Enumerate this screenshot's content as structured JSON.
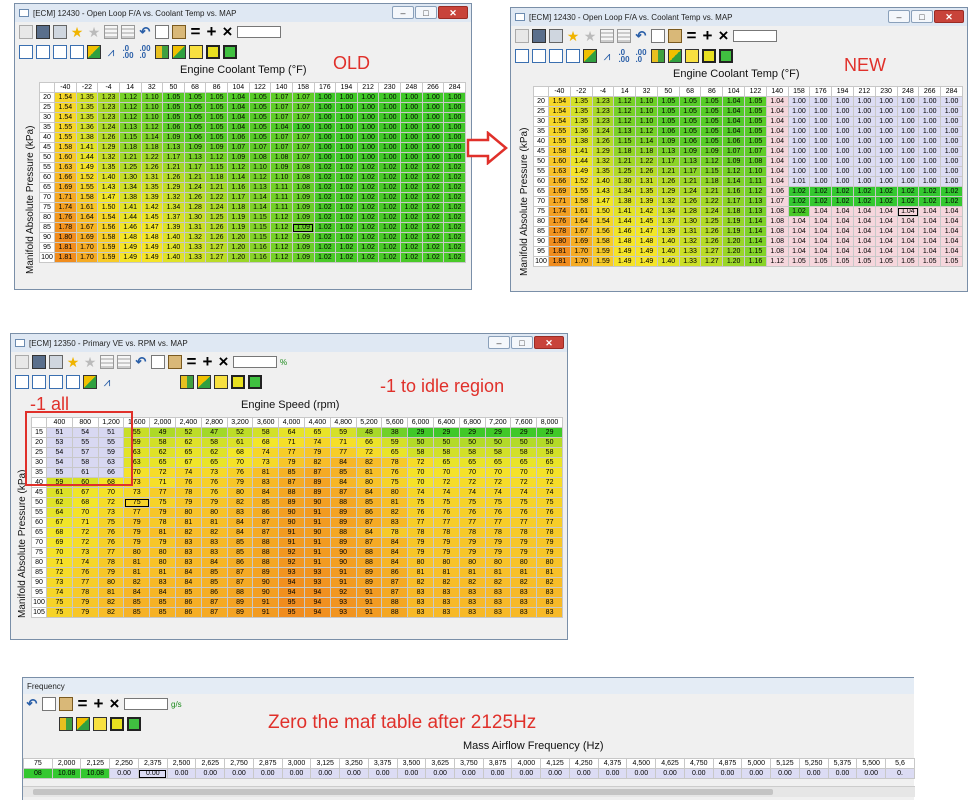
{
  "windows": {
    "old": {
      "title": "[ECM] 12430 - Open Loop F/A vs. Coolant Temp vs. MAP",
      "x_axis_title": "Engine Coolant Temp (°F)",
      "y_axis_title": "Manifold Absolute Pressure (kPa)"
    },
    "new": {
      "title": "[ECM] 12430 - Open Loop F/A vs. Coolant Temp vs. MAP",
      "x_axis_title": "Engine Coolant Temp (°F)",
      "y_axis_title": "Manifold Absolute Pressure (kPa)"
    },
    "ve": {
      "title": "[ECM] 12350 - Primary VE vs. RPM vs. MAP",
      "x_axis_title": "Engine Speed (rpm)",
      "y_axis_title": "Manifold Absolute Pressure (kPa)",
      "unit": "%"
    },
    "maf": {
      "title": "Frequency",
      "x_axis_title": "Mass Airflow Frequency (Hz)",
      "unit": "g/s"
    }
  },
  "annotations": {
    "old": "OLD",
    "new": "NEW",
    "ve_idle": "-1 to idle region",
    "ve_all": "-1 all",
    "maf": "Zero the maf table after 2125Hz"
  },
  "fa_cols": [
    "-40",
    "-22",
    "-4",
    "14",
    "32",
    "50",
    "68",
    "86",
    "104",
    "122",
    "140",
    "158",
    "176",
    "194",
    "212",
    "230",
    "248",
    "266",
    "284"
  ],
  "fa_rows": [
    "20",
    "25",
    "30",
    "35",
    "40",
    "45",
    "50",
    "55",
    "60",
    "65",
    "70",
    "75",
    "80",
    "85",
    "90",
    "95",
    "100"
  ],
  "fa_old": [
    [
      "1.54",
      "1.35",
      "1.23",
      "1.12",
      "1.10",
      "1.05",
      "1.05",
      "1.05",
      "1.04",
      "1.05",
      "1.07",
      "1.07",
      "1.00",
      "1.00",
      "1.00",
      "1.00",
      "1.00",
      "1.00",
      "1.00"
    ],
    [
      "1.54",
      "1.35",
      "1.23",
      "1.12",
      "1.10",
      "1.05",
      "1.05",
      "1.05",
      "1.04",
      "1.05",
      "1.07",
      "1.07",
      "1.00",
      "1.00",
      "1.00",
      "1.00",
      "1.00",
      "1.00",
      "1.00"
    ],
    [
      "1.54",
      "1.35",
      "1.23",
      "1.12",
      "1.10",
      "1.05",
      "1.05",
      "1.05",
      "1.04",
      "1.05",
      "1.07",
      "1.07",
      "1.00",
      "1.00",
      "1.00",
      "1.00",
      "1.00",
      "1.00",
      "1.00"
    ],
    [
      "1.55",
      "1.36",
      "1.24",
      "1.13",
      "1.12",
      "1.06",
      "1.05",
      "1.05",
      "1.04",
      "1.05",
      "1.04",
      "1.00",
      "1.00",
      "1.00",
      "1.00",
      "1.00",
      "1.00",
      "1.00",
      "1.00"
    ],
    [
      "1.55",
      "1.38",
      "1.26",
      "1.15",
      "1.14",
      "1.09",
      "1.06",
      "1.05",
      "1.06",
      "1.05",
      "1.07",
      "1.07",
      "1.00",
      "1.00",
      "1.00",
      "1.00",
      "1.00",
      "1.00",
      "1.00"
    ],
    [
      "1.58",
      "1.41",
      "1.29",
      "1.18",
      "1.18",
      "1.13",
      "1.09",
      "1.09",
      "1.07",
      "1.07",
      "1.07",
      "1.07",
      "1.00",
      "1.00",
      "1.00",
      "1.00",
      "1.00",
      "1.00",
      "1.00"
    ],
    [
      "1.60",
      "1.44",
      "1.32",
      "1.21",
      "1.22",
      "1.17",
      "1.13",
      "1.12",
      "1.09",
      "1.08",
      "1.08",
      "1.07",
      "1.00",
      "1.00",
      "1.00",
      "1.00",
      "1.00",
      "1.00",
      "1.00"
    ],
    [
      "1.63",
      "1.49",
      "1.35",
      "1.25",
      "1.26",
      "1.21",
      "1.17",
      "1.15",
      "1.12",
      "1.10",
      "1.09",
      "1.08",
      "1.02",
      "1.02",
      "1.02",
      "1.02",
      "1.02",
      "1.02",
      "1.02"
    ],
    [
      "1.66",
      "1.52",
      "1.40",
      "1.30",
      "1.31",
      "1.26",
      "1.21",
      "1.18",
      "1.14",
      "1.12",
      "1.10",
      "1.08",
      "1.02",
      "1.02",
      "1.02",
      "1.02",
      "1.02",
      "1.02",
      "1.02"
    ],
    [
      "1.69",
      "1.55",
      "1.43",
      "1.34",
      "1.35",
      "1.29",
      "1.24",
      "1.21",
      "1.16",
      "1.13",
      "1.11",
      "1.08",
      "1.02",
      "1.02",
      "1.02",
      "1.02",
      "1.02",
      "1.02",
      "1.02"
    ],
    [
      "1.71",
      "1.58",
      "1.47",
      "1.38",
      "1.39",
      "1.32",
      "1.26",
      "1.22",
      "1.17",
      "1.14",
      "1.11",
      "1.09",
      "1.02",
      "1.02",
      "1.02",
      "1.02",
      "1.02",
      "1.02",
      "1.02"
    ],
    [
      "1.74",
      "1.61",
      "1.50",
      "1.41",
      "1.42",
      "1.34",
      "1.28",
      "1.24",
      "1.18",
      "1.14",
      "1.11",
      "1.09",
      "1.02",
      "1.02",
      "1.02",
      "1.02",
      "1.02",
      "1.02",
      "1.02"
    ],
    [
      "1.76",
      "1.64",
      "1.54",
      "1.44",
      "1.45",
      "1.37",
      "1.30",
      "1.25",
      "1.19",
      "1.15",
      "1.12",
      "1.09",
      "1.02",
      "1.02",
      "1.02",
      "1.02",
      "1.02",
      "1.02",
      "1.02"
    ],
    [
      "1.78",
      "1.67",
      "1.56",
      "1.46",
      "1.47",
      "1.39",
      "1.31",
      "1.26",
      "1.19",
      "1.15",
      "1.12",
      "1.09",
      "1.02",
      "1.02",
      "1.02",
      "1.02",
      "1.02",
      "1.02",
      "1.02"
    ],
    [
      "1.80",
      "1.69",
      "1.58",
      "1.48",
      "1.48",
      "1.40",
      "1.32",
      "1.26",
      "1.20",
      "1.15",
      "1.12",
      "1.09",
      "1.02",
      "1.02",
      "1.02",
      "1.02",
      "1.02",
      "1.02",
      "1.02"
    ],
    [
      "1.81",
      "1.70",
      "1.59",
      "1.49",
      "1.49",
      "1.40",
      "1.33",
      "1.27",
      "1.20",
      "1.16",
      "1.12",
      "1.09",
      "1.02",
      "1.02",
      "1.02",
      "1.02",
      "1.02",
      "1.02",
      "1.02"
    ],
    [
      "1.81",
      "1.70",
      "1.59",
      "1.49",
      "1.49",
      "1.40",
      "1.33",
      "1.27",
      "1.20",
      "1.16",
      "1.12",
      "1.09",
      "1.02",
      "1.02",
      "1.02",
      "1.02",
      "1.02",
      "1.02",
      "1.02"
    ]
  ],
  "fa_new": [
    [
      "1.54",
      "1.35",
      "1.23",
      "1.12",
      "1.10",
      "1.05",
      "1.05",
      "1.05",
      "1.04",
      "1.05",
      "1.04",
      "1.00",
      "1.00",
      "1.00",
      "1.00",
      "1.00",
      "1.00",
      "1.00",
      "1.00"
    ],
    [
      "1.54",
      "1.35",
      "1.23",
      "1.12",
      "1.10",
      "1.05",
      "1.05",
      "1.05",
      "1.04",
      "1.05",
      "1.04",
      "1.00",
      "1.00",
      "1.00",
      "1.00",
      "1.00",
      "1.00",
      "1.00",
      "1.00"
    ],
    [
      "1.54",
      "1.35",
      "1.23",
      "1.12",
      "1.10",
      "1.05",
      "1.05",
      "1.05",
      "1.04",
      "1.05",
      "1.04",
      "1.00",
      "1.00",
      "1.00",
      "1.00",
      "1.00",
      "1.00",
      "1.00",
      "1.00"
    ],
    [
      "1.55",
      "1.36",
      "1.24",
      "1.13",
      "1.12",
      "1.06",
      "1.05",
      "1.05",
      "1.04",
      "1.05",
      "1.04",
      "1.00",
      "1.00",
      "1.00",
      "1.00",
      "1.00",
      "1.00",
      "1.00",
      "1.00"
    ],
    [
      "1.55",
      "1.38",
      "1.26",
      "1.15",
      "1.14",
      "1.09",
      "1.06",
      "1.05",
      "1.06",
      "1.05",
      "1.04",
      "1.00",
      "1.00",
      "1.00",
      "1.00",
      "1.00",
      "1.00",
      "1.00",
      "1.00"
    ],
    [
      "1.58",
      "1.41",
      "1.29",
      "1.18",
      "1.18",
      "1.13",
      "1.09",
      "1.09",
      "1.07",
      "1.07",
      "1.04",
      "1.00",
      "1.00",
      "1.00",
      "1.00",
      "1.00",
      "1.00",
      "1.00",
      "1.00"
    ],
    [
      "1.60",
      "1.44",
      "1.32",
      "1.21",
      "1.22",
      "1.17",
      "1.13",
      "1.12",
      "1.09",
      "1.08",
      "1.04",
      "1.00",
      "1.00",
      "1.00",
      "1.00",
      "1.00",
      "1.00",
      "1.00",
      "1.00"
    ],
    [
      "1.63",
      "1.49",
      "1.35",
      "1.25",
      "1.26",
      "1.21",
      "1.17",
      "1.15",
      "1.12",
      "1.10",
      "1.04",
      "1.00",
      "1.00",
      "1.00",
      "1.00",
      "1.00",
      "1.00",
      "1.00",
      "1.00"
    ],
    [
      "1.66",
      "1.52",
      "1.40",
      "1.30",
      "1.31",
      "1.26",
      "1.21",
      "1.18",
      "1.14",
      "1.11",
      "1.04",
      "1.01",
      "1.00",
      "1.00",
      "1.00",
      "1.00",
      "1.00",
      "1.00",
      "1.00"
    ],
    [
      "1.69",
      "1.55",
      "1.43",
      "1.34",
      "1.35",
      "1.29",
      "1.24",
      "1.21",
      "1.16",
      "1.12",
      "1.06",
      "1.02",
      "1.02",
      "1.02",
      "1.02",
      "1.02",
      "1.02",
      "1.02",
      "1.02"
    ],
    [
      "1.71",
      "1.58",
      "1.47",
      "1.38",
      "1.39",
      "1.32",
      "1.26",
      "1.22",
      "1.17",
      "1.13",
      "1.07",
      "1.02",
      "1.02",
      "1.02",
      "1.02",
      "1.02",
      "1.02",
      "1.02",
      "1.02"
    ],
    [
      "1.74",
      "1.61",
      "1.50",
      "1.41",
      "1.42",
      "1.34",
      "1.28",
      "1.24",
      "1.18",
      "1.13",
      "1.08",
      "1.02",
      "1.04",
      "1.04",
      "1.04",
      "1.04",
      "1.04",
      "1.04",
      "1.04"
    ],
    [
      "1.76",
      "1.64",
      "1.54",
      "1.44",
      "1.45",
      "1.37",
      "1.30",
      "1.25",
      "1.19",
      "1.14",
      "1.08",
      "1.04",
      "1.04",
      "1.04",
      "1.04",
      "1.04",
      "1.04",
      "1.04",
      "1.04"
    ],
    [
      "1.78",
      "1.67",
      "1.56",
      "1.46",
      "1.47",
      "1.39",
      "1.31",
      "1.26",
      "1.19",
      "1.14",
      "1.08",
      "1.04",
      "1.04",
      "1.04",
      "1.04",
      "1.04",
      "1.04",
      "1.04",
      "1.04"
    ],
    [
      "1.80",
      "1.69",
      "1.58",
      "1.48",
      "1.48",
      "1.40",
      "1.32",
      "1.26",
      "1.20",
      "1.14",
      "1.08",
      "1.04",
      "1.04",
      "1.04",
      "1.04",
      "1.04",
      "1.04",
      "1.04",
      "1.04"
    ],
    [
      "1.81",
      "1.70",
      "1.59",
      "1.49",
      "1.49",
      "1.40",
      "1.33",
      "1.27",
      "1.20",
      "1.15",
      "1.08",
      "1.04",
      "1.04",
      "1.04",
      "1.04",
      "1.04",
      "1.04",
      "1.04",
      "1.04"
    ],
    [
      "1.81",
      "1.70",
      "1.59",
      "1.49",
      "1.49",
      "1.40",
      "1.33",
      "1.27",
      "1.20",
      "1.16",
      "1.12",
      "1.05",
      "1.05",
      "1.05",
      "1.05",
      "1.05",
      "1.05",
      "1.05",
      "1.05"
    ]
  ],
  "ve_cols": [
    "400",
    "800",
    "1,200",
    "1,600",
    "2,000",
    "2,400",
    "2,800",
    "3,200",
    "3,600",
    "4,000",
    "4,400",
    "4,800",
    "5,200",
    "5,600",
    "6,000",
    "6,400",
    "6,800",
    "7,200",
    "7,600",
    "8,000"
  ],
  "ve_rows": [
    "15",
    "20",
    "25",
    "30",
    "35",
    "40",
    "45",
    "50",
    "55",
    "60",
    "65",
    "70",
    "75",
    "80",
    "85",
    "90",
    "95",
    "100",
    "105"
  ],
  "ve_vals": [
    [
      51,
      54,
      51,
      55,
      49,
      52,
      47,
      52,
      58,
      64,
      65,
      59,
      48,
      38,
      29,
      29,
      29,
      29,
      29,
      29
    ],
    [
      53,
      55,
      55,
      59,
      58,
      62,
      58,
      61,
      68,
      71,
      74,
      71,
      66,
      59,
      50,
      50,
      50,
      50,
      50,
      50
    ],
    [
      54,
      57,
      59,
      63,
      62,
      65,
      62,
      68,
      74,
      77,
      79,
      77,
      72,
      65,
      58,
      58,
      58,
      58,
      58,
      58
    ],
    [
      54,
      58,
      63,
      63,
      65,
      67,
      65,
      70,
      73,
      79,
      82,
      84,
      82,
      78,
      72,
      65,
      65,
      65,
      65,
      65
    ],
    [
      55,
      61,
      66,
      70,
      72,
      74,
      73,
      76,
      81,
      85,
      87,
      85,
      81,
      76,
      70,
      70,
      70,
      70,
      70,
      70
    ],
    [
      59,
      60,
      68,
      73,
      71,
      76,
      76,
      79,
      83,
      87,
      89,
      84,
      80,
      75,
      70,
      72,
      72,
      72,
      72,
      72
    ],
    [
      61,
      67,
      70,
      73,
      77,
      78,
      76,
      80,
      84,
      88,
      89,
      87,
      84,
      80,
      74,
      74,
      74,
      74,
      74,
      74
    ],
    [
      62,
      68,
      72,
      75,
      75,
      79,
      79,
      82,
      85,
      89,
      90,
      88,
      85,
      81,
      75,
      75,
      75,
      75,
      75,
      75
    ],
    [
      64,
      70,
      73,
      77,
      79,
      80,
      80,
      83,
      86,
      90,
      91,
      89,
      86,
      82,
      76,
      76,
      76,
      76,
      76,
      76
    ],
    [
      67,
      71,
      75,
      79,
      78,
      81,
      81,
      84,
      87,
      90,
      91,
      89,
      87,
      83,
      77,
      77,
      77,
      77,
      77,
      77
    ],
    [
      68,
      72,
      76,
      79,
      81,
      82,
      82,
      84,
      87,
      91,
      90,
      88,
      84,
      78,
      78,
      78,
      78,
      78,
      78,
      78
    ],
    [
      69,
      72,
      76,
      79,
      79,
      83,
      83,
      85,
      88,
      91,
      91,
      89,
      87,
      84,
      79,
      79,
      79,
      79,
      79,
      79
    ],
    [
      70,
      73,
      77,
      80,
      80,
      83,
      83,
      85,
      88,
      92,
      91,
      90,
      88,
      84,
      79,
      79,
      79,
      79,
      79,
      79
    ],
    [
      71,
      74,
      78,
      81,
      80,
      83,
      84,
      86,
      88,
      92,
      91,
      90,
      88,
      84,
      80,
      80,
      80,
      80,
      80,
      80
    ],
    [
      72,
      76,
      79,
      81,
      81,
      84,
      85,
      87,
      89,
      93,
      93,
      91,
      89,
      86,
      81,
      81,
      81,
      81,
      81,
      81
    ],
    [
      73,
      77,
      80,
      82,
      83,
      84,
      85,
      87,
      90,
      94,
      93,
      91,
      89,
      87,
      82,
      82,
      82,
      82,
      82,
      82
    ],
    [
      74,
      78,
      81,
      84,
      84,
      85,
      86,
      88,
      90,
      94,
      94,
      92,
      91,
      87,
      83,
      83,
      83,
      83,
      83,
      83
    ],
    [
      75,
      79,
      82,
      85,
      85,
      86,
      87,
      89,
      91,
      95,
      94,
      93,
      91,
      88,
      83,
      83,
      83,
      83,
      83,
      83
    ],
    [
      75,
      79,
      82,
      85,
      85,
      86,
      87,
      89,
      91,
      95,
      94,
      93,
      91,
      88,
      83,
      83,
      83,
      83,
      83,
      83
    ]
  ],
  "maf_cols": [
    "75",
    "2,000",
    "2,125",
    "2,250",
    "2,375",
    "2,500",
    "2,625",
    "2,750",
    "2,875",
    "3,000",
    "3,125",
    "3,250",
    "3,375",
    "3,500",
    "3,625",
    "3,750",
    "3,875",
    "4,000",
    "4,125",
    "4,250",
    "4,375",
    "4,500",
    "4,625",
    "4,750",
    "4,875",
    "5,000",
    "5,125",
    "5,250",
    "5,375",
    "5,500",
    "5,6"
  ],
  "maf_vals": [
    "08",
    "10.08",
    "10.08",
    "0.00",
    "0.00",
    "0.00",
    "0.00",
    "0.00",
    "0.00",
    "0.00",
    "0.00",
    "0.00",
    "0.00",
    "0.00",
    "0.00",
    "0.00",
    "0.00",
    "0.00",
    "0.00",
    "0.00",
    "0.00",
    "0.00",
    "0.00",
    "0.00",
    "0.00",
    "0.00",
    "0.00",
    "0.00",
    "0.00",
    "0.00",
    "0."
  ]
}
